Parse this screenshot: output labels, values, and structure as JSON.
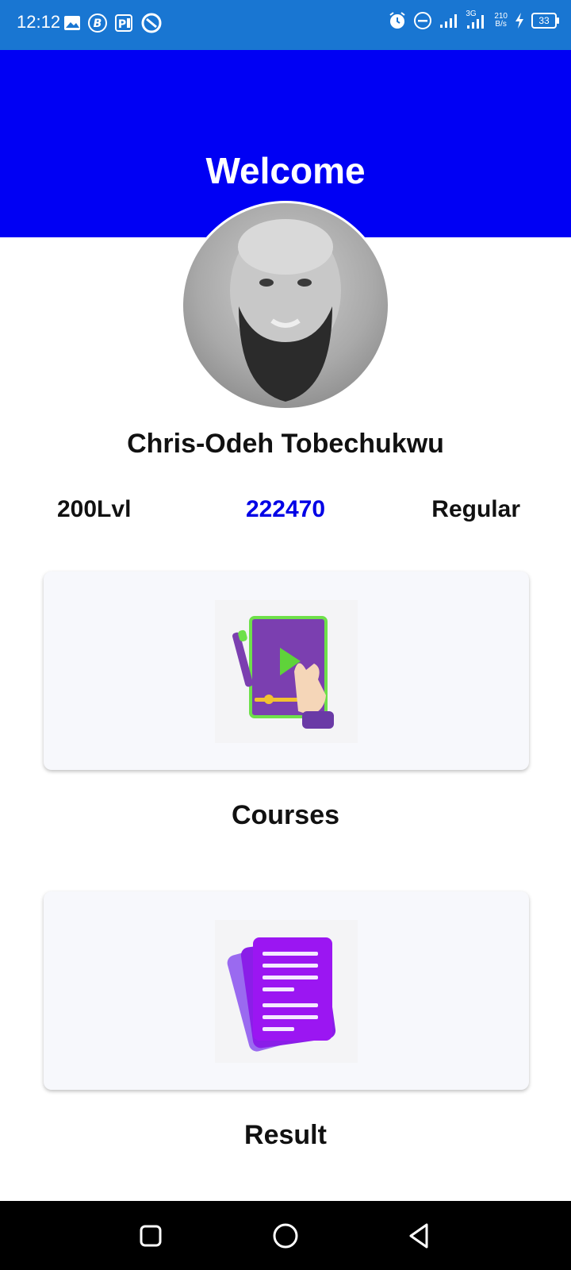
{
  "status_bar": {
    "time": "12:12",
    "left_icons": [
      "image-icon",
      "b-app-icon",
      "p-app-icon",
      "vpn-icon"
    ],
    "network": "3G",
    "speed_value": "210",
    "speed_unit": "B/s",
    "battery": "33"
  },
  "header": {
    "title": "Welcome"
  },
  "profile": {
    "name": "Chris-Odeh Tobechukwu",
    "level": "200Lvl",
    "id": "222470",
    "type": "Regular"
  },
  "cards": {
    "courses_label": "Courses",
    "result_label": "Result"
  },
  "colors": {
    "status_bar": "#1976d2",
    "header": "#0000f4",
    "id_accent": "#0000e6",
    "card_bg": "#f7f8fc"
  }
}
